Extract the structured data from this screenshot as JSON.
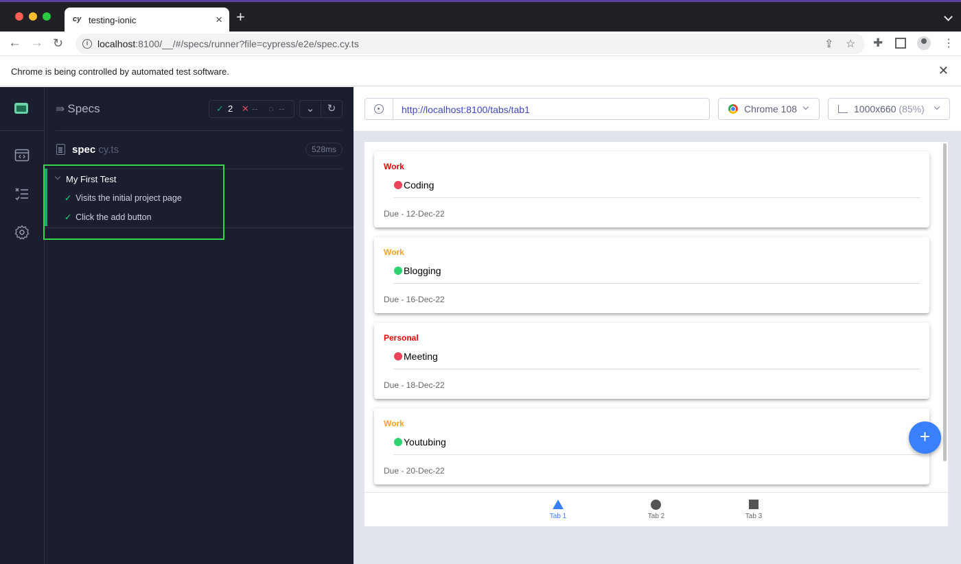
{
  "browser": {
    "tab_title": "testing-ionic",
    "favicon_text": "cy",
    "url_host": "localhost",
    "url_rest": ":8100/__/#/specs/runner?file=cypress/e2e/spec.cy.ts",
    "automation_notice": "Chrome is being controlled by automated test software."
  },
  "reporter": {
    "header": "Specs",
    "passed": "2",
    "failed": "--",
    "pending": "--",
    "spec_name": "spec",
    "spec_ext": " cy.ts",
    "duration": "528ms",
    "suite_title": "My First Test",
    "tests": [
      {
        "title": "Visits the initial project page"
      },
      {
        "title": "Click the add button"
      }
    ]
  },
  "aut": {
    "url": "http://localhost:8100/tabs/tab1",
    "browser_label": "Chrome 108",
    "viewport_size": "1000x660",
    "viewport_scale": " (85%)"
  },
  "app": {
    "cards": [
      {
        "category": "Work",
        "category_color": "#eb0000",
        "title": "Coding",
        "dot_color": "#eb445a",
        "due": "Due - 12-Dec-22"
      },
      {
        "category": "Work",
        "category_color": "#f7a21b",
        "title": "Blogging",
        "dot_color": "#2dd36f",
        "due": "Due - 16-Dec-22"
      },
      {
        "category": "Personal",
        "category_color": "#eb0000",
        "title": "Meeting",
        "dot_color": "#eb445a",
        "due": "Due - 18-Dec-22"
      },
      {
        "category": "Work",
        "category_color": "#f7a21b",
        "title": "Youtubing",
        "dot_color": "#2dd36f",
        "due": "Due - 20-Dec-22"
      }
    ],
    "fab_label": "+",
    "tabs": [
      {
        "label": "Tab 1",
        "icon": "triangle-icon",
        "active": true
      },
      {
        "label": "Tab 2",
        "icon": "ellipse-icon",
        "active": false
      },
      {
        "label": "Tab 3",
        "icon": "square-icon",
        "active": false
      }
    ]
  },
  "colors": {
    "passed": "#1fa971",
    "failed": "#e8495f",
    "accent": "#3880ff"
  }
}
